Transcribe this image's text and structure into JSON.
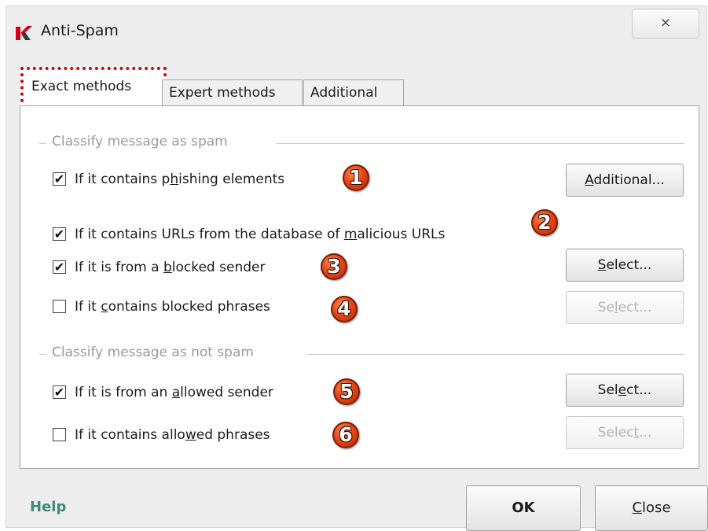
{
  "window": {
    "title": "Anti-Spam",
    "close_glyph": "×",
    "logo_icon": "kaspersky-logo-icon"
  },
  "tabs": [
    {
      "label": "Exact methods",
      "active": true
    },
    {
      "label": "Expert methods",
      "active": false
    },
    {
      "label": "Additional",
      "active": false
    }
  ],
  "groups": {
    "spam": {
      "title": "Classify message as spam"
    },
    "not_spam": {
      "title": "Classify message as not spam"
    }
  },
  "options": [
    {
      "pre": "If it contains p",
      "ul": "h",
      "post": "ishing elements",
      "checked": true,
      "marker": "1",
      "button": {
        "pre": "",
        "ul": "A",
        "post": "dditional...",
        "enabled": true
      }
    },
    {
      "pre": "If it contains URLs from the database of ",
      "ul": "m",
      "post": "alicious URLs",
      "checked": true,
      "marker": "2",
      "button": null
    },
    {
      "pre": "If it is from a ",
      "ul": "b",
      "post": "locked sender",
      "checked": true,
      "marker": "3",
      "button": {
        "pre": "",
        "ul": "S",
        "post": "elect...",
        "enabled": true
      }
    },
    {
      "pre": "If it ",
      "ul": "c",
      "post": "ontains blocked phrases",
      "checked": false,
      "marker": "4",
      "button": {
        "pre": "Se",
        "ul": "l",
        "post": "ect...",
        "enabled": false
      }
    },
    {
      "pre": "If it is from an ",
      "ul": "a",
      "post": "llowed sender",
      "checked": true,
      "marker": "5",
      "button": {
        "pre": "Sel",
        "ul": "e",
        "post": "ct...",
        "enabled": true
      }
    },
    {
      "pre": "If it contains allo",
      "ul": "w",
      "post": "ed phrases",
      "checked": false,
      "marker": "6",
      "button": {
        "pre": "Selec",
        "ul": "t",
        "post": "...",
        "enabled": false
      }
    }
  ],
  "checkmark_glyph": "✔",
  "footer": {
    "help_label": "Help",
    "ok_label": "OK",
    "close_pre": "",
    "close_ul": "C",
    "close_post": "lose"
  },
  "colors": {
    "highlight_dotted": "#d20000",
    "marker": "#e8461a",
    "help_link": "#3d8a79"
  }
}
